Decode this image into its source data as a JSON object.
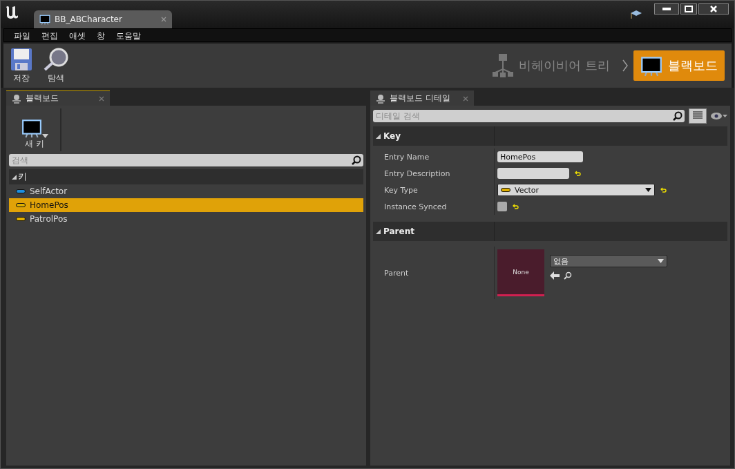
{
  "window": {
    "document_tab": "BB_ABCharacter"
  },
  "menu": [
    "파일",
    "편집",
    "애셋",
    "창",
    "도움말"
  ],
  "toolbar": [
    {
      "label": "저장",
      "kind": "save"
    },
    {
      "label": "탐색",
      "kind": "browse"
    }
  ],
  "modes": [
    {
      "label": "비헤이비어 트리",
      "kind": "tree",
      "selected": false
    },
    {
      "label": "블랙보드",
      "kind": "blackboard",
      "selected": true
    }
  ],
  "left_panel": {
    "tab": "블랙보드",
    "new_key": "새 키",
    "search": {
      "placeholder": "검색"
    },
    "category": "키",
    "keys": [
      {
        "name": "SelfActor",
        "color": "#1e8fe0",
        "selected": false
      },
      {
        "name": "HomePos",
        "color": "#e0b000",
        "selected": true
      },
      {
        "name": "PatrolPos",
        "color": "#e0b000",
        "selected": false
      }
    ]
  },
  "details": {
    "tab": "블랙보드 디테일",
    "search": {
      "placeholder": "디테일 검색"
    },
    "sections": [
      {
        "title": "Key",
        "expanded": true,
        "rows": [
          {
            "kind": "text",
            "label": "Entry Name",
            "value": "HomePos",
            "reset": false
          },
          {
            "kind": "text",
            "label": "Entry Description",
            "reset": true
          },
          {
            "kind": "dropdown",
            "label": "Key Type",
            "value": "Vector",
            "color": "#e0b000",
            "reset": true
          },
          {
            "kind": "checkbox",
            "label": "Instance Synced",
            "checked": false,
            "reset": true
          }
        ]
      },
      {
        "title": "Parent",
        "expanded": true,
        "rows": [
          {
            "kind": "asset",
            "label": "Parent",
            "thumbnail": "None",
            "value": "없음"
          }
        ]
      }
    ]
  }
}
